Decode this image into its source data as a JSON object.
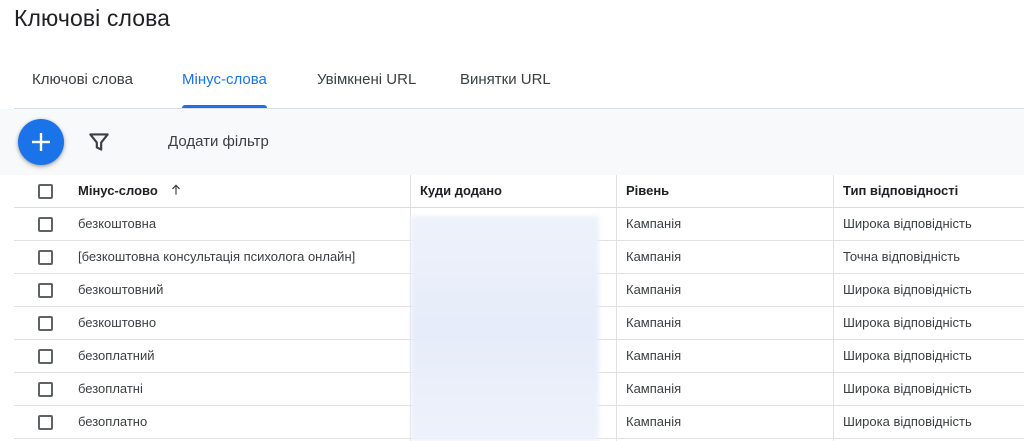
{
  "page": {
    "title": "Ключові слова"
  },
  "tabs": [
    {
      "label": "Ключові слова",
      "active": false
    },
    {
      "label": "Мінус-слова",
      "active": true
    },
    {
      "label": "Увімкнені URL",
      "active": false
    },
    {
      "label": "Винятки URL",
      "active": false
    }
  ],
  "toolbar": {
    "add_icon": "plus-icon",
    "filter_icon": "filter-funnel-icon",
    "add_filter_label": "Додати фільтр"
  },
  "table": {
    "columns": {
      "keyword": "Мінус-слово",
      "added_to": "Куди додано",
      "level": "Рівень",
      "match_type": "Тип відповідності"
    },
    "sort_icon": "arrow-up-icon",
    "rows": [
      {
        "keyword": "безкоштовна",
        "level": "Кампанія",
        "match_type": "Широка відповідність"
      },
      {
        "keyword": "[безкоштовна консультація психолога онлайн]",
        "level": "Кампанія",
        "match_type": "Точна відповідність"
      },
      {
        "keyword": "безкоштовний",
        "level": "Кампанія",
        "match_type": "Широка відповідність"
      },
      {
        "keyword": "безкоштовно",
        "level": "Кампанія",
        "match_type": "Широка відповідність"
      },
      {
        "keyword": "безоплатний",
        "level": "Кампанія",
        "match_type": "Широка відповідність"
      },
      {
        "keyword": "безоплатні",
        "level": "Кампанія",
        "match_type": "Широка відповідність"
      },
      {
        "keyword": "безоплатно",
        "level": "Кампанія",
        "match_type": "Широка відповідність"
      }
    ]
  },
  "colors": {
    "accent": "#1a73e8",
    "text": "#3c4043",
    "toolbar_bg": "#f8f9fa"
  }
}
